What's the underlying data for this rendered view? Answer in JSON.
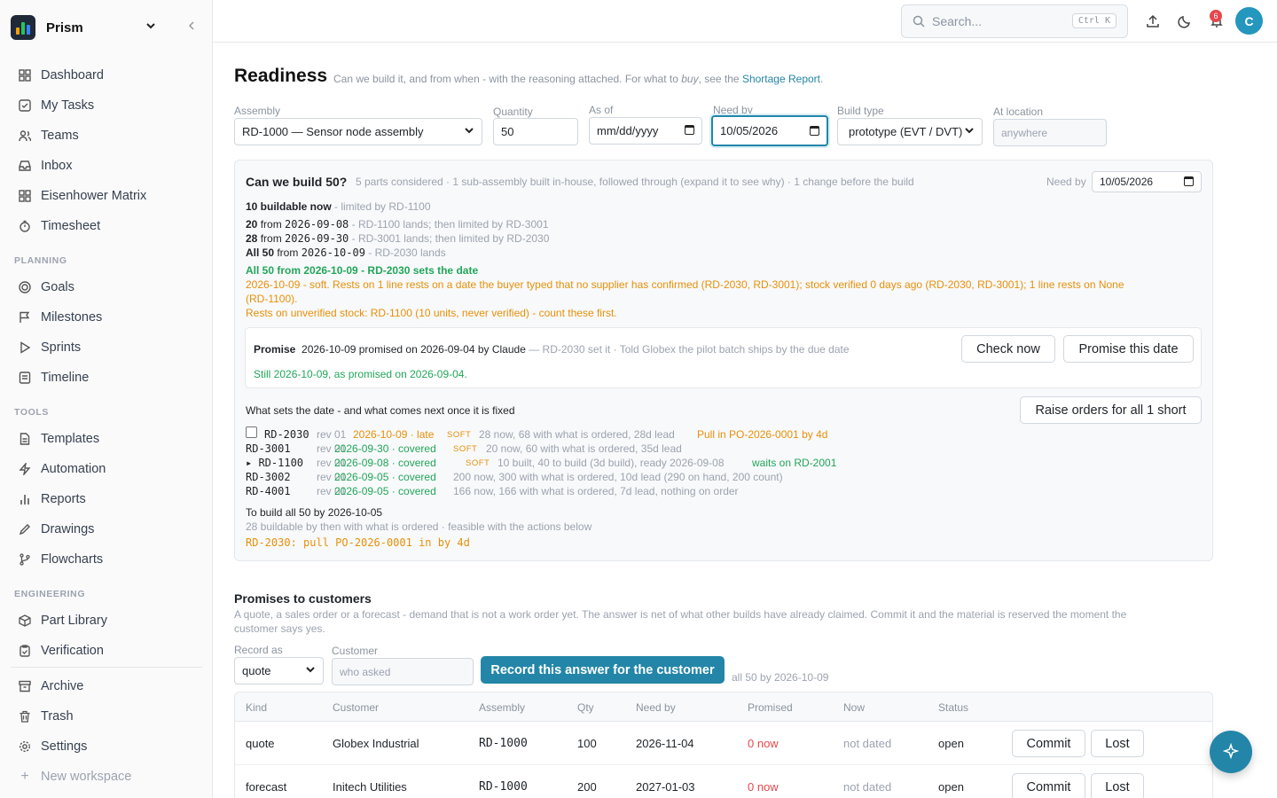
{
  "sidebar": {
    "workspace": "Prism",
    "items_main": [
      {
        "label": "Dashboard",
        "icon": "grid-icon"
      },
      {
        "label": "My Tasks",
        "icon": "check-square-icon"
      },
      {
        "label": "Teams",
        "icon": "users-icon"
      },
      {
        "label": "Inbox",
        "icon": "inbox-icon"
      },
      {
        "label": "Eisenhower Matrix",
        "icon": "grid-icon"
      },
      {
        "label": "Timesheet",
        "icon": "timer-icon"
      }
    ],
    "section_planning": "PLANNING",
    "items_planning": [
      {
        "label": "Goals",
        "icon": "target-icon"
      },
      {
        "label": "Milestones",
        "icon": "flag-icon"
      },
      {
        "label": "Sprints",
        "icon": "play-icon"
      },
      {
        "label": "Timeline",
        "icon": "list-icon"
      }
    ],
    "section_tools": "TOOLS",
    "items_tools": [
      {
        "label": "Templates",
        "icon": "file-icon"
      },
      {
        "label": "Automation",
        "icon": "zap-icon"
      },
      {
        "label": "Reports",
        "icon": "bar-chart-icon"
      },
      {
        "label": "Drawings",
        "icon": "pen-icon"
      },
      {
        "label": "Flowcharts",
        "icon": "git-branch-icon"
      }
    ],
    "section_engineering": "ENGINEERING",
    "items_engineering": [
      {
        "label": "Part Library",
        "icon": "package-icon"
      },
      {
        "label": "Verification",
        "icon": "clipboard-check-icon"
      }
    ],
    "items_bottom": [
      {
        "label": "Archive",
        "icon": "archive-icon"
      },
      {
        "label": "Trash",
        "icon": "trash-icon"
      },
      {
        "label": "Settings",
        "icon": "gear-icon"
      }
    ],
    "new_workspace": "New workspace"
  },
  "topbar": {
    "search_placeholder": "Search...",
    "search_shortcut": "Ctrl K",
    "notification_count": "6",
    "avatar_initial": "C"
  },
  "page": {
    "title": "Readiness",
    "subtitle_a": "Can we build it, and from when - with the reasoning attached. For what to ",
    "subtitle_em": "buy",
    "subtitle_b": ", see the ",
    "subtitle_link": "Shortage Report",
    "subtitle_end": "."
  },
  "filters": {
    "assembly_label": "Assembly",
    "assembly_value": "RD-1000 — Sensor node assembly",
    "quantity_label": "Quantity",
    "quantity_value": "50",
    "asof_label": "As of",
    "asof_value": "mm/dd/yyyy",
    "needby_label": "Need by",
    "needby_value": "10/05/2026",
    "buildtype_label": "Build type",
    "buildtype_value": "prototype (EVT / DVT)",
    "location_label": "At location",
    "location_placeholder": "anywhere"
  },
  "panel": {
    "heading": "Can we build 50?",
    "summary": "5 parts considered · 1 sub-assembly built in-house, followed through (expand it to see why) · 1 change before the build",
    "needby_label": "Need by",
    "needby_value": "10/05/2026",
    "buildable_bold": "10 buildable now",
    "buildable_rest": " - limited by RD-1100",
    "steps": [
      {
        "qty": "20",
        "pre": " from ",
        "date": "2026-09-08",
        "note": " - RD-1100 lands; then limited by RD-3001"
      },
      {
        "qty": "28",
        "pre": " from ",
        "date": "2026-09-30",
        "note": " - RD-3001 lands; then limited by RD-2030"
      },
      {
        "qty": "All 50",
        "pre": " from ",
        "date": "2026-10-09",
        "note": " - RD-2030 lands"
      }
    ],
    "verdict": "All 50 from 2026-10-09 - RD-2030 sets the date",
    "warning1": "2026-10-09 - soft. Rests on 1 line rests on a date the buyer typed that no supplier has confirmed (RD-2030, RD-3001); stock verified 0 days ago (RD-2030, RD-3001); 1 line rests on None",
    "warning1b": "(RD-1100).",
    "warning2": "Rests on unverified stock: RD-1100 (10 units, never verified) - count these first.",
    "promise": {
      "label": "Promise",
      "text": "2026-10-09 promised on 2026-09-04 by Claude",
      "note": " — RD-2030 set it · Told Globex the pilot batch ships by the due date",
      "status": "Still 2026-10-09, as promised on 2026-09-04.",
      "check_button": "Check now",
      "promise_button": "Promise this date"
    },
    "sets_date_heading": "What sets the date - and what comes next once it is fixed",
    "raise_button": "Raise orders for all 1 short",
    "parts": [
      {
        "part": "RD-2030",
        "rev": "rev 01",
        "date": "2026-10-09 · late",
        "date_color": "orange",
        "soft": "SOFT",
        "detail": "28 now, 68 with what is ordered, 28d lead",
        "action": "Pull in PO-2026-0001 by 4d",
        "action_color": "orange"
      },
      {
        "part": "RD-3001",
        "rev": "rev 01",
        "date": "2026-09-30 · covered",
        "date_color": "green",
        "soft": "SOFT",
        "detail": "20 now, 60 with what is ordered, 35d lead",
        "action": "",
        "action_color": ""
      },
      {
        "part": "▸ RD-1100",
        "rev": "rev 01",
        "date": "2026-09-08 · covered",
        "date_color": "green",
        "soft": "SOFT",
        "detail": "10 built, 40 to build (3d build), ready 2026-09-08",
        "action": "waits on RD-2001",
        "action_color": "green"
      },
      {
        "part": "RD-3002",
        "rev": "rev 01",
        "date": "2026-09-05 · covered",
        "date_color": "green",
        "soft": "",
        "detail": "200 now, 300 with what is ordered, 10d lead  (290 on hand, 200 count)",
        "action": "",
        "action_color": ""
      },
      {
        "part": "RD-4001",
        "rev": "rev 01",
        "date": "2026-09-05 · covered",
        "date_color": "green",
        "soft": "",
        "detail": "166 now, 166 with what is ordered, 7d lead, nothing on order",
        "action": "",
        "action_color": ""
      }
    ],
    "tobuild_heading": "To build all 50 by 2026-10-05",
    "tobuild_detail": "28 buildable by then with what is ordered · feasible with the actions below",
    "tobuild_action": "RD-2030: pull PO-2026-0001 in by 4d"
  },
  "promises": {
    "heading": "Promises to customers",
    "desc1": "A quote, a sales order or a forecast - demand that is not a work order yet. The answer is net of what other builds have already claimed. Commit it and the material is reserved the moment the",
    "desc2": "customer says yes.",
    "record_label": "Record as",
    "record_value": "quote",
    "customer_label": "Customer",
    "customer_placeholder": "who asked",
    "record_button": "Record this answer for the customer",
    "record_note": "all 50 by 2026-10-09",
    "columns": [
      "Kind",
      "Customer",
      "Assembly",
      "Qty",
      "Need by",
      "Promised",
      "Now",
      "Status"
    ],
    "rows": [
      {
        "kind": "quote",
        "customer": "Globex Industrial",
        "assembly": "RD-1000",
        "qty": "100",
        "needby": "2026-11-04",
        "promised": "0 now",
        "now": "not dated",
        "status": "open",
        "commit": "Commit",
        "lost": "Lost"
      },
      {
        "kind": "forecast",
        "customer": "Initech Utilities",
        "assembly": "RD-1000",
        "qty": "200",
        "needby": "2027-01-03",
        "promised": "0 now",
        "now": "not dated",
        "status": "open",
        "commit": "Commit",
        "lost": "Lost"
      }
    ]
  },
  "colors": {
    "accent": "#2386a8",
    "green": "#22a65a",
    "orange": "#e6900a",
    "danger": "#e5484d"
  }
}
